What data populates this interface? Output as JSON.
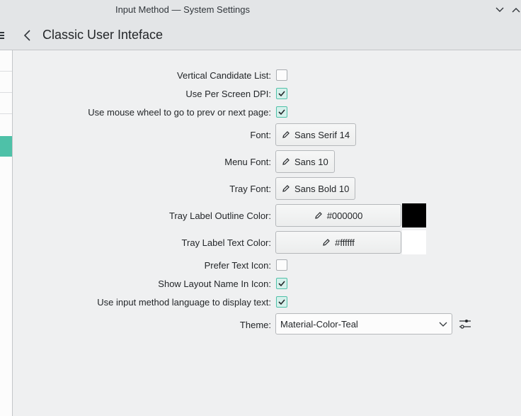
{
  "window": {
    "title": "Input Method — System Settings"
  },
  "header": {
    "page_title": "Classic User Inteface"
  },
  "form": {
    "vertical_candidate_list": {
      "label": "Vertical Candidate List:",
      "checked": false
    },
    "per_screen_dpi": {
      "label": "Use Per Screen DPI:",
      "checked": true
    },
    "mouse_wheel": {
      "label": "Use mouse wheel to go to prev or next page:",
      "checked": true
    },
    "font": {
      "label": "Font:",
      "value": "Sans Serif 14"
    },
    "menu_font": {
      "label": "Menu Font:",
      "value": "Sans 10"
    },
    "tray_font": {
      "label": "Tray Font:",
      "value": "Sans Bold 10"
    },
    "tray_outline_color": {
      "label": "Tray Label Outline Color:",
      "value": "#000000",
      "swatch": "#000000"
    },
    "tray_text_color": {
      "label": "Tray Label Text Color:",
      "value": "#ffffff",
      "swatch": "#ffffff"
    },
    "prefer_text_icon": {
      "label": "Prefer Text Icon:",
      "checked": false
    },
    "show_layout_name": {
      "label": "Show Layout Name In Icon:",
      "checked": true
    },
    "use_im_language": {
      "label": "Use input method language to display text:",
      "checked": true
    },
    "theme": {
      "label": "Theme:",
      "value": "Material-Color-Teal"
    }
  },
  "icons": {
    "back": "arrow-left-icon",
    "menu": "hamburger-icon",
    "minimize": "chevron-down-icon",
    "maximize": "chevron-up-icon",
    "edit": "pencil-icon",
    "configure": "sliders-icon"
  },
  "colors": {
    "accent": "#4ec1a8",
    "window_bg": "#eff0f1",
    "header_bg": "#e3e5e7"
  }
}
